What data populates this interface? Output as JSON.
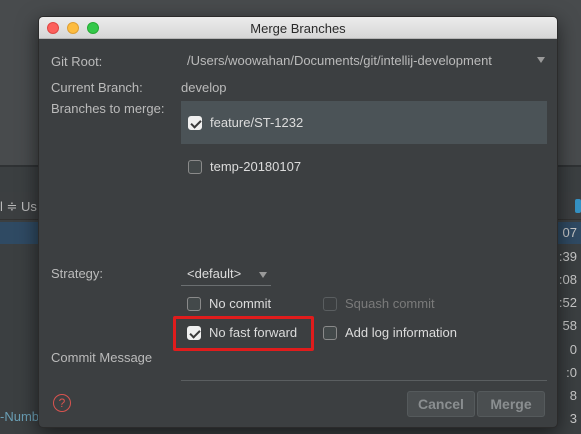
{
  "background": {
    "toolbar_left": "l ≑  Us",
    "numbers": [
      "07",
      ":39",
      ":08",
      ":52",
      "58",
      "0",
      ":0",
      "8",
      "3"
    ],
    "number_text": "-Numb"
  },
  "dialog": {
    "title": "Merge Branches",
    "git_root_label": "Git Root:",
    "git_root_value": "/Users/woowahan/Documents/git/intellij-development",
    "current_branch_label": "Current Branch:",
    "current_branch_value": "develop",
    "branches_label": "Branches to merge:",
    "branches": [
      {
        "name": "feature/ST-1232",
        "checked": true
      },
      {
        "name": "temp-20180107",
        "checked": false
      }
    ],
    "strategy_label": "Strategy:",
    "strategy_value": "<default>",
    "options": {
      "no_commit": "No commit",
      "squash_commit": "Squash commit",
      "no_fast_forward": "No fast forward",
      "add_log": "Add log information"
    },
    "commit_message_label": "Commit Message",
    "cancel_label": "Cancel",
    "merge_label": "Merge",
    "help_icon": "?"
  },
  "colors": {
    "highlight": "#e01c1c",
    "dialog_bg": "#3c3f41",
    "selected_row": "#4b5357"
  }
}
